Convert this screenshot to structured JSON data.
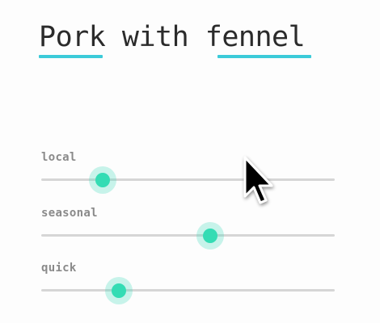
{
  "title": {
    "words": [
      "Pork",
      "with",
      "fennel"
    ],
    "underline_color": "#3ccbd9"
  },
  "sliders": [
    {
      "label": "local",
      "value": 0.21
    },
    {
      "label": "seasonal",
      "value": 0.575
    },
    {
      "label": "quick",
      "value": 0.265
    }
  ],
  "colors": {
    "thumb": "#34dcb4",
    "track": "#d6d6d6",
    "text": "#2b2b2b",
    "label": "#8a8a8a"
  },
  "cursor": {
    "icon": "arrow-cursor-icon"
  }
}
